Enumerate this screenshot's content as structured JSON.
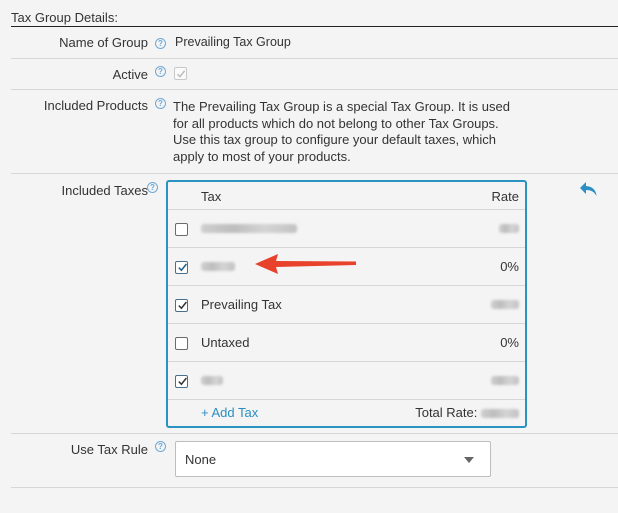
{
  "section": {
    "title": "Tax Group Details:"
  },
  "fields": {
    "name_label": "Name of Group",
    "name_value": "Prevailing Tax Group",
    "active_label": "Active",
    "included_products_label": "Included Products",
    "included_products_text": "The Prevailing Tax Group is a special Tax Group. It is used for all products which do not belong to other Tax Groups. Use this tax group to configure your default taxes, which apply to most of your products.",
    "included_taxes_label": "Included Taxes",
    "tax_rule_label": "Use Tax Rule"
  },
  "tax_table": {
    "col_tax": "Tax",
    "col_rate": "Rate",
    "rows": [
      {
        "name": "",
        "rate": "",
        "checked": false
      },
      {
        "name": "",
        "rate": "0%",
        "checked": true
      },
      {
        "name": "Prevailing Tax",
        "rate": "",
        "checked": true
      },
      {
        "name": "Untaxed",
        "rate": "0%",
        "checked": false
      },
      {
        "name": "",
        "rate": "",
        "checked": true
      }
    ],
    "add_label": "+ Add Tax",
    "total_label": "Total Rate:"
  },
  "tax_rule": {
    "selected": "None"
  },
  "help_glyph": "?",
  "colors": {
    "accent": "#2b93c2",
    "link": "#2b8fc4",
    "annotation_arrow": "#e8412c"
  }
}
